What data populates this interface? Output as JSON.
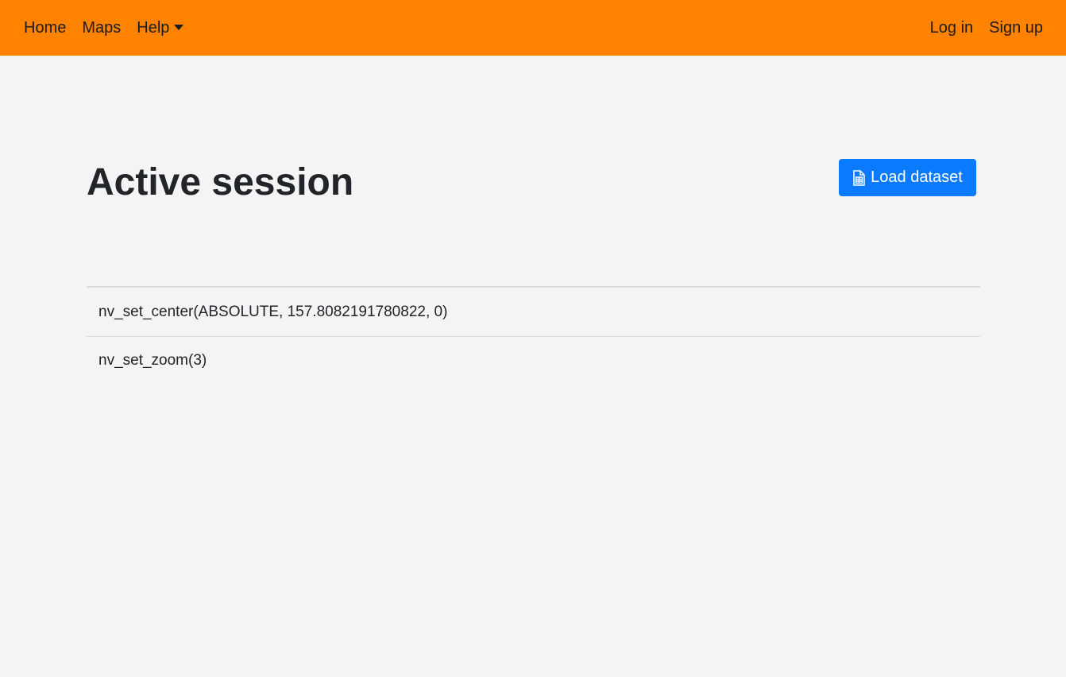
{
  "navbar": {
    "background": "#ff8200",
    "left_items": [
      {
        "label": "Home"
      },
      {
        "label": "Maps"
      },
      {
        "label": "Help",
        "dropdown": true
      }
    ],
    "right_items": [
      {
        "label": "Log in"
      },
      {
        "label": "Sign up"
      }
    ]
  },
  "main": {
    "title": "Active session",
    "load_button": {
      "label": "Load dataset",
      "icon": "file-spreadsheet-icon",
      "color": "#0a7bff"
    },
    "commands": [
      "nv_set_center(ABSOLUTE, 157.8082191780822, 0)",
      "nv_set_zoom(3)"
    ]
  }
}
